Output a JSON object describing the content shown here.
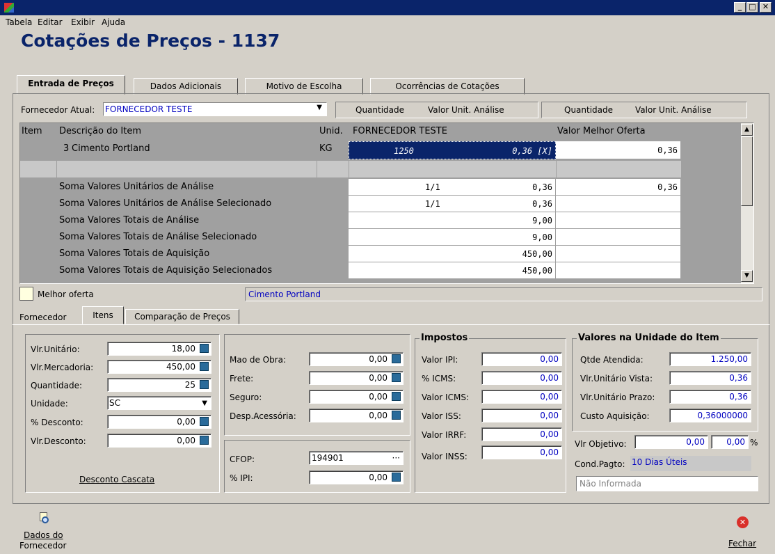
{
  "window": {
    "min": "_",
    "max": "□",
    "close": "✕"
  },
  "menu": [
    "Tabela",
    "Editar",
    "Exibir",
    "Ajuda"
  ],
  "page_title": "Cotações de Preços - 1137",
  "tabs": [
    "Entrada de Preços",
    "Dados Adicionais",
    "Motivo de Escolha",
    "Ocorrências de Cotações"
  ],
  "supplier": {
    "label": "Fornecedor Atual:",
    "value": "FORNECEDOR TESTE",
    "hdr1": {
      "qty": "Quantidade",
      "unit": "Valor Unit. Análise"
    },
    "hdr2": {
      "qty": "Quantidade",
      "unit": "Valor Unit. Análise"
    }
  },
  "grid": {
    "headers": {
      "item": "Item",
      "desc": "Descrição do Item",
      "unid": "Unid.",
      "supplier": "FORNECEDOR TESTE",
      "best": "Valor Melhor Oferta"
    },
    "row": {
      "item": "3",
      "desc": "Cimento Portland",
      "unid": "KG",
      "qty": "1250",
      "price": "0,36 [X]",
      "best": "0,36"
    },
    "sums": [
      {
        "label": "Soma Valores Unitários de Análise",
        "count": "1/1",
        "value": "0,36",
        "best": "0,36"
      },
      {
        "label": "Soma Valores Unitários de Análise Selecionado",
        "count": "1/1",
        "value": "0,36",
        "best": ""
      },
      {
        "label": "Soma Valores Totais de Análise",
        "count": "",
        "value": "9,00",
        "best": ""
      },
      {
        "label": "Soma Valores Totais de Análise Selecionado",
        "count": "",
        "value": "9,00",
        "best": ""
      },
      {
        "label": "Soma Valores Totais de Aquisição",
        "count": "",
        "value": "450,00",
        "best": ""
      },
      {
        "label": "Soma Valores Totais de Aquisição Selecionados",
        "count": "",
        "value": "450,00",
        "best": ""
      }
    ]
  },
  "legend": {
    "label": "Melhor oferta",
    "selected_item": "Cimento Portland"
  },
  "subtabs": [
    "Fornecedor",
    "Itens",
    "Comparação de Preços"
  ],
  "items_panel": {
    "vlr_unitario": {
      "label": "Vlr.Unitário:",
      "value": "18,00"
    },
    "vlr_mercadoria": {
      "label": "Vlr.Mercadoria:",
      "value": "450,00"
    },
    "quantidade": {
      "label": "Quantidade:",
      "value": "25"
    },
    "unidade": {
      "label": "Unidade:",
      "value": "SC"
    },
    "pct_desconto": {
      "label": "% Desconto:",
      "value": "0,00"
    },
    "vlr_desconto": {
      "label": "Vlr.Desconto:",
      "value": "0,00"
    },
    "desconto_cascata": "Desconto Cascata"
  },
  "costs_panel": {
    "mao_obra": {
      "label": "Mao de Obra:",
      "value": "0,00"
    },
    "frete": {
      "label": "Frete:",
      "value": "0,00"
    },
    "seguro": {
      "label": "Seguro:",
      "value": "0,00"
    },
    "desp": {
      "label": "Desp.Acessória:",
      "value": "0,00"
    },
    "cfop": {
      "label": "CFOP:",
      "value": "194901"
    },
    "pct_ipi": {
      "label": "% IPI:",
      "value": "0,00"
    }
  },
  "impostos": {
    "title": "Impostos",
    "rows": [
      {
        "label": "Valor IPI:",
        "value": "0,00"
      },
      {
        "label": "% ICMS:",
        "value": "0,00"
      },
      {
        "label": "Valor ICMS:",
        "value": "0,00"
      },
      {
        "label": "Valor ISS:",
        "value": "0,00"
      },
      {
        "label": "Valor IRRF:",
        "value": "0,00"
      },
      {
        "label": "Valor INSS:",
        "value": "0,00"
      }
    ]
  },
  "valores_unidade": {
    "title": "Valores na Unidade do Item",
    "rows": [
      {
        "label": "Qtde Atendida:",
        "value": "1.250,00"
      },
      {
        "label": "Vlr.Unitário Vista:",
        "value": "0,36"
      },
      {
        "label": "Vlr.Unitário Prazo:",
        "value": "0,36"
      },
      {
        "label": "Custo Aquisição:",
        "value": "0,36000000"
      }
    ],
    "vlr_objetivo": {
      "label": "Vlr Objetivo:",
      "value": "0,00",
      "pct": "0,00",
      "pct_sign": "%"
    },
    "cond_pagto": {
      "label": "Cond.Pagto:",
      "value": "10 Dias Úteis"
    },
    "nao_informada": "Não Informada"
  },
  "footer": {
    "dados_fornecedor_1": "Dados do",
    "dados_fornecedor_2": "Fornecedor",
    "fechar": "Fechar"
  },
  "colors": {
    "title_blue": "#0a246a",
    "selection": "#0a246a",
    "value_blue": "#0000c0",
    "close_red": "#d9302a"
  }
}
